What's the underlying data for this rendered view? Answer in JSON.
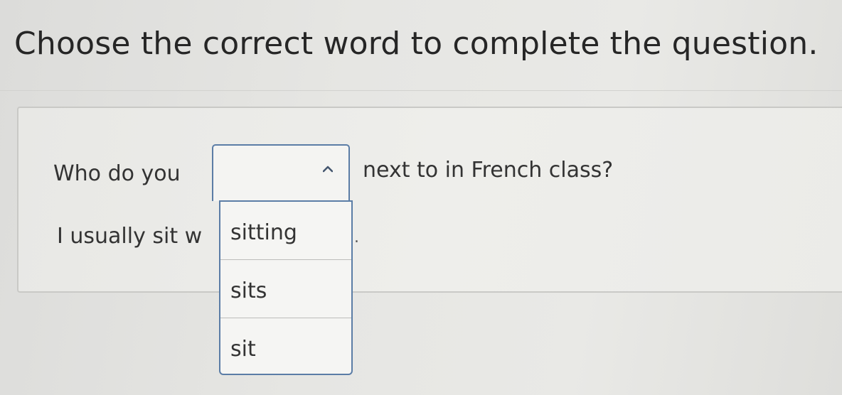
{
  "instruction": "Choose the correct word to complete the question.",
  "question": {
    "before_select": "Who do you",
    "after_select": "next to in French class?"
  },
  "answer": {
    "visible_start": "I usually sit w",
    "end_punctuation": "."
  },
  "dropdown": {
    "selected_value": "",
    "open": true,
    "chevron_icon": "chevron-up-icon",
    "options": [
      "sitting",
      "sits",
      "sit"
    ]
  },
  "colors": {
    "select_border": "#5b7da6"
  }
}
